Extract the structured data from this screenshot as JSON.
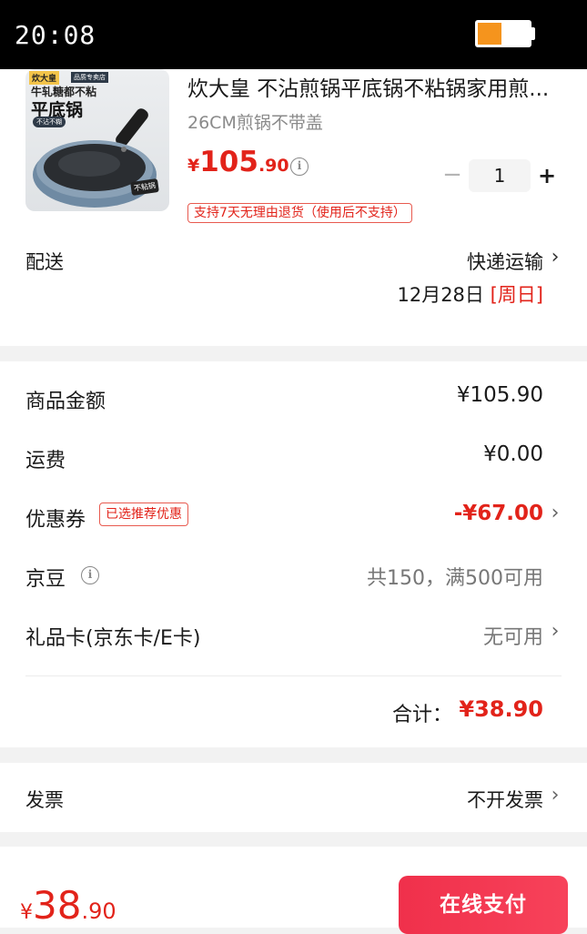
{
  "status_bar": {
    "time": "20:08"
  },
  "product": {
    "title": "炊大皇 不沾煎锅平底锅不粘锅家用煎...",
    "spec": "26CM煎锅不带盖",
    "price": {
      "currency": "¥",
      "integer": "105",
      "decimal": ".90"
    },
    "quantity": "1",
    "minus": "−",
    "plus": "+",
    "return_policy": "支持7天无理由退货（使用后不支持）",
    "image": {
      "brand": "炊大皇",
      "store_tag": "品质专卖店",
      "line1": "牛轧糖都不粘",
      "line2": "平底锅",
      "pill": "不沾不糊",
      "badge": "不粘锅"
    }
  },
  "delivery": {
    "label": "配送",
    "method": "快递运输",
    "date": "12月28日",
    "weekday": "[周日]"
  },
  "summary": {
    "goods_amount": {
      "label": "商品金额",
      "value": "¥105.90"
    },
    "shipping": {
      "label": "运费",
      "value": "¥0.00"
    },
    "coupon": {
      "label": "优惠券",
      "tag": "已选推荐优惠",
      "value": "-¥67.00"
    },
    "jingdou": {
      "label": "京豆",
      "value": "共150，满500可用"
    },
    "gift_card": {
      "label": "礼品卡(京东卡/E卡)",
      "value": "无可用"
    },
    "total": {
      "label": "合计：",
      "value": "¥38.90"
    }
  },
  "invoice": {
    "label": "发票",
    "value": "不开发票"
  },
  "footer": {
    "price": {
      "currency": "¥",
      "integer": "38",
      "decimal": ".90"
    },
    "pay_button": "在线支付"
  },
  "icons": {
    "info": "info-icon",
    "chevron": "chevron-right-icon"
  },
  "colors": {
    "accent_red": "#e2231a",
    "pay_button": "#f0304b",
    "battery": "#f5941d"
  }
}
